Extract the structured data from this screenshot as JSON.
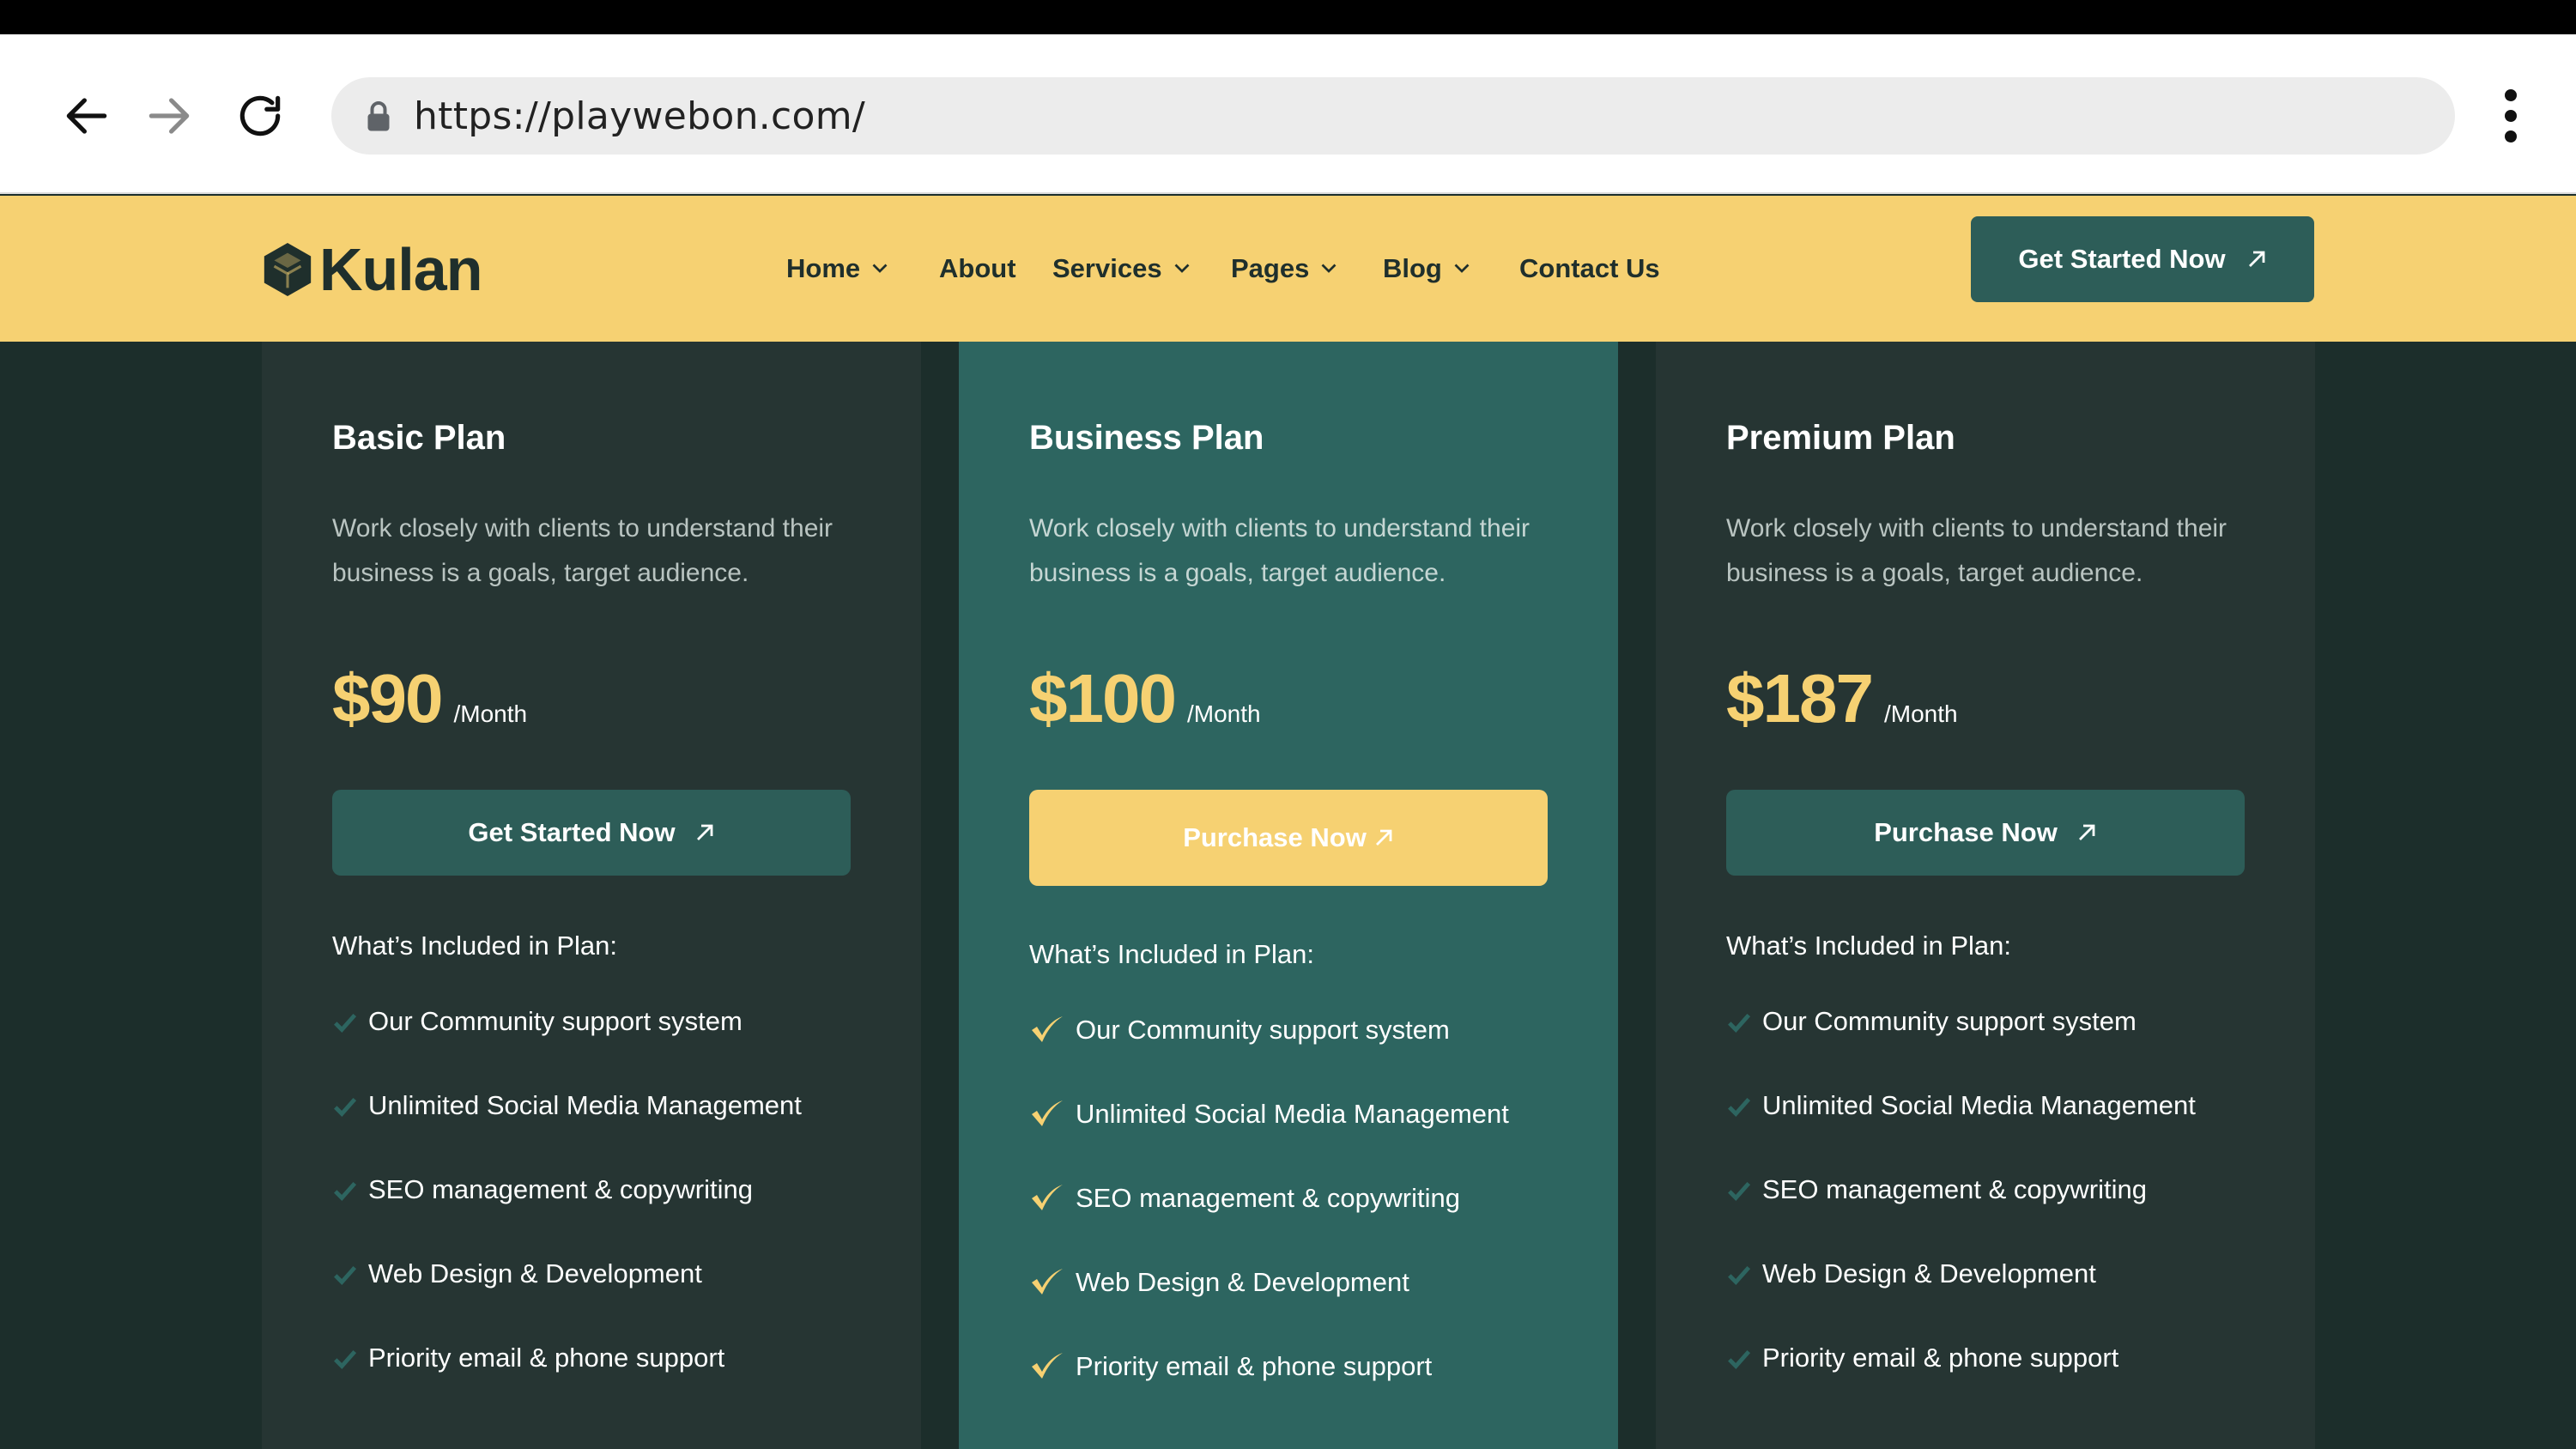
{
  "browser": {
    "url": "https://playwebon.com/"
  },
  "header": {
    "logo_text": "Kulan",
    "nav": [
      {
        "label": "Home",
        "has_dropdown": true
      },
      {
        "label": "About",
        "has_dropdown": false
      },
      {
        "label": "Services",
        "has_dropdown": true
      },
      {
        "label": "Pages",
        "has_dropdown": true
      },
      {
        "label": "Blog",
        "has_dropdown": true
      },
      {
        "label": "Contact Us",
        "has_dropdown": false
      }
    ],
    "cta_label": "Get Started Now"
  },
  "plans": [
    {
      "title": "Basic Plan",
      "description": "Work closely with clients to understand their business is a goals, target audience.",
      "price": "$90",
      "period": "/Month",
      "button_label": "Get Started Now",
      "included_heading": "What’s Included in Plan:",
      "features": [
        "Our Community support system",
        "Unlimited Social Media Management",
        "SEO management & copywriting",
        "Web Design & Development",
        "Priority email & phone support"
      ]
    },
    {
      "title": "Business Plan",
      "description": "Work closely with clients to understand their business is a goals, target audience.",
      "price": "$100",
      "period": "/Month",
      "button_label": "Purchase Now",
      "included_heading": "What’s Included in Plan:",
      "features": [
        "Our Community support system",
        "Unlimited Social Media Management",
        "SEO management & copywriting",
        "Web Design & Development",
        "Priority email & phone support"
      ]
    },
    {
      "title": "Premium Plan",
      "description": "Work closely with clients to understand their business is a goals, target audience.",
      "price": "$187",
      "period": "/Month",
      "button_label": "Purchase Now",
      "included_heading": "What’s Included in Plan:",
      "features": [
        "Our Community support system",
        "Unlimited Social Media Management",
        "SEO management & copywriting",
        "Web Design & Development",
        "Priority email & phone support"
      ]
    }
  ],
  "colors": {
    "header_bg": "#f6d172",
    "accent_teal": "#2d5d58",
    "featured_card": "#2d6560",
    "card_bg": "#263533",
    "page_bg": "#1c2e2b",
    "price_yellow": "#f6d172"
  }
}
